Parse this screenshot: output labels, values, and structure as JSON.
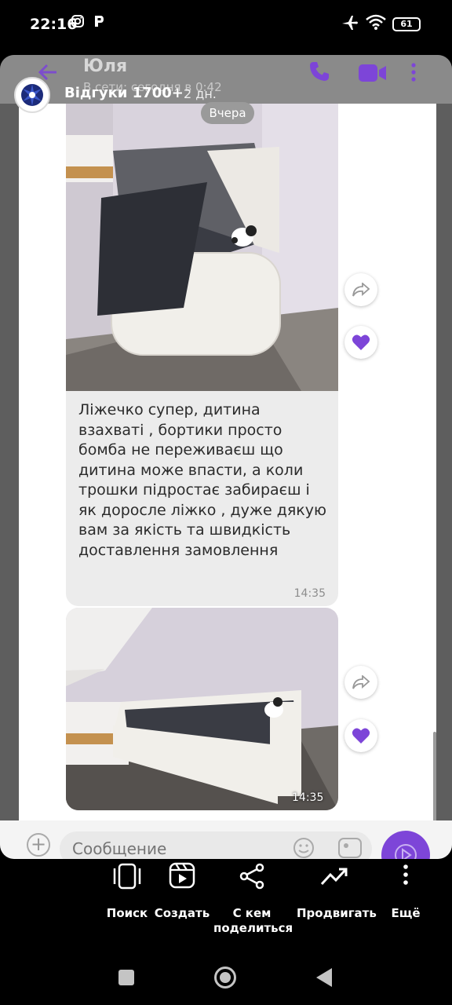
{
  "status_bar": {
    "time": "22:16",
    "battery": "61",
    "icons": [
      "instagram-icon",
      "p-app-icon",
      "airplane-icon",
      "wifi-icon",
      "battery-icon"
    ]
  },
  "viber_header": {
    "contact_name": "Юля",
    "last_seen": "В сети: сегодня в 0:42",
    "icons": [
      "back-arrow-icon",
      "phone-icon",
      "video-call-icon",
      "more-vertical-icon"
    ],
    "accent_color": "#7d45d8"
  },
  "story": {
    "account_name": "Відгуки 1700+",
    "post_age": "2 дн."
  },
  "chat": {
    "date_separator": "Вчера",
    "messages": [
      {
        "type": "photo",
        "description_icon": "bed-photo"
      },
      {
        "type": "text",
        "text": "Ліжечко супер, дитина взахваті , бортики просто бомба не переживаєш що дитина може впасти, а коли трошки підростає забираєш і як доросле ліжко , дуже дякую вам за якість та швидкість доставлення замовлення",
        "time": "14:35"
      },
      {
        "type": "photo",
        "description_icon": "bed-photo",
        "time": "14:35"
      }
    ],
    "like_color": "#7d45d8"
  },
  "composer": {
    "placeholder": "Сообщение"
  },
  "actions": [
    {
      "label": "Поиск",
      "icon": "search-frame-icon"
    },
    {
      "label": "Создать",
      "icon": "create-reel-icon"
    },
    {
      "label": "С кем поделиться",
      "icon": "share-icon"
    },
    {
      "label": "Продвигать",
      "icon": "trending-up-icon"
    },
    {
      "label": "Ещё",
      "icon": "more-vertical-icon"
    }
  ],
  "navbar": {
    "icons": [
      "recents-square-icon",
      "home-circle-icon",
      "back-triangle-icon"
    ]
  }
}
